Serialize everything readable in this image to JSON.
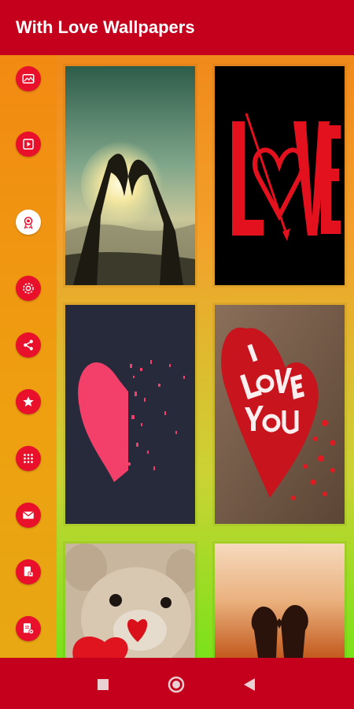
{
  "app": {
    "title": "With Love Wallpapers"
  },
  "colors": {
    "brand": "#c4001d",
    "icon_bg": "#e8102b",
    "sidebar": "#f29412"
  },
  "sidebar": {
    "items": [
      {
        "icon": "gallery-icon"
      },
      {
        "icon": "video-icon"
      },
      {
        "icon": "award-icon"
      },
      {
        "icon": "settings-icon"
      },
      {
        "icon": "share-icon"
      },
      {
        "icon": "star-icon"
      },
      {
        "icon": "apps-grid-icon"
      },
      {
        "icon": "mail-icon"
      },
      {
        "icon": "privacy-doc-icon"
      },
      {
        "icon": "terms-doc-icon"
      }
    ]
  },
  "grid": {
    "items": [
      {
        "name": "heart-hands-sunset"
      },
      {
        "name": "love-text-arrow"
      },
      {
        "name": "pixel-heart"
      },
      {
        "name": "i-love-you-heart"
      },
      {
        "name": "teddy-bear-heart"
      },
      {
        "name": "couple-silhouette"
      }
    ]
  },
  "navbar": {
    "buttons": [
      {
        "icon": "recent-apps-icon"
      },
      {
        "icon": "home-icon"
      },
      {
        "icon": "back-icon"
      }
    ]
  }
}
